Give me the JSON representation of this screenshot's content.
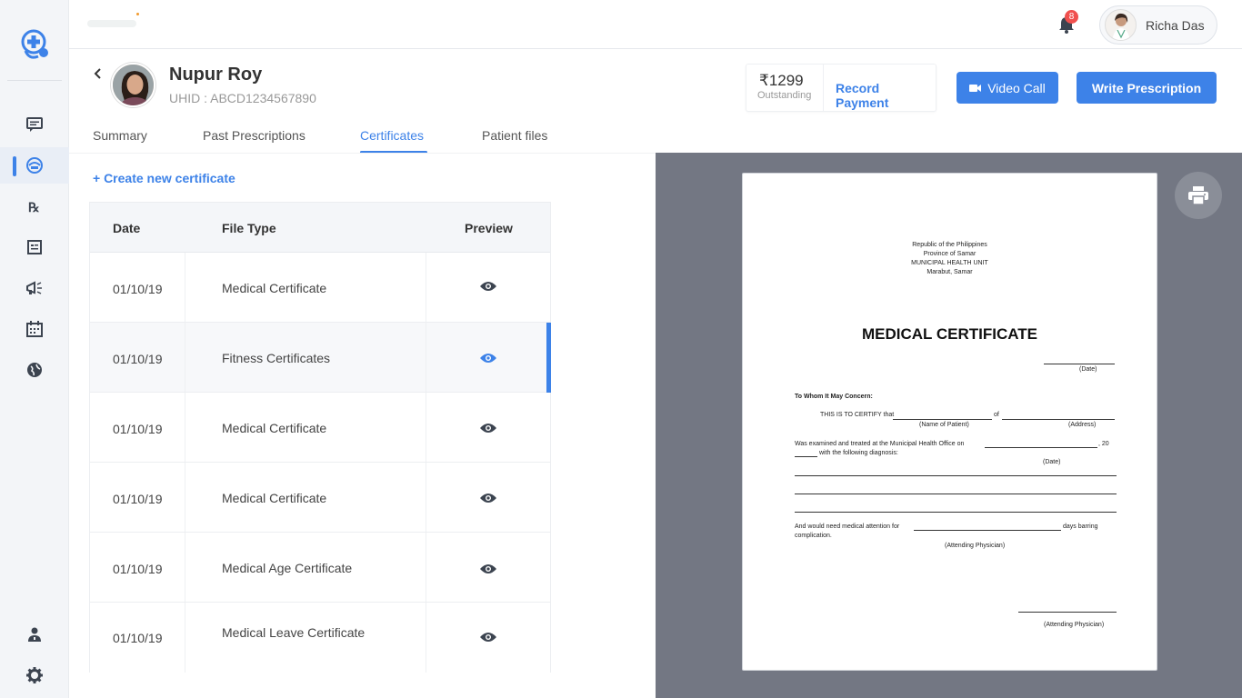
{
  "header": {
    "notification_count": "8",
    "user_name": "Richa Das"
  },
  "patient": {
    "name": "Nupur Roy",
    "uhid": "UHID : ABCD1234567890"
  },
  "payment": {
    "amount": "₹1299",
    "status": "Outstanding",
    "record_label": "Record Payment"
  },
  "actions": {
    "video_call": "Video Call",
    "write_prescription": "Write Prescription"
  },
  "tabs": [
    {
      "label": "Summary",
      "active": false
    },
    {
      "label": "Past Prescriptions",
      "active": false
    },
    {
      "label": "Certificates",
      "active": true
    },
    {
      "label": "Patient files",
      "active": false
    }
  ],
  "create_link": "+ Create new certificate",
  "table": {
    "columns": [
      "Date",
      "File Type",
      "Preview"
    ],
    "rows": [
      {
        "date": "01/10/19",
        "type": "Medical Certificate"
      },
      {
        "date": "01/10/19",
        "type": "Fitness Certificates"
      },
      {
        "date": "01/10/19",
        "type": "Medical Certificate"
      },
      {
        "date": "01/10/19",
        "type": "Medical Certificate"
      },
      {
        "date": "01/10/19",
        "type": "Medical Age Certificate"
      },
      {
        "date": "01/10/19",
        "type": "Medical Leave Certificate"
      }
    ],
    "selected_index": 1
  },
  "document": {
    "header_lines": [
      "Republic of the Philippines",
      "Province of Samar",
      "MUNICIPAL HEALTH UNIT",
      "Marabut, Samar"
    ],
    "title": "MEDICAL CERTIFICATE",
    "date_label": "(Date)",
    "salutation": "To Whom It May Concern:",
    "certify": "THIS IS TO CERTIFY that",
    "of": "of",
    "name_label": "(Name of Patient)",
    "address_label": "(Address)",
    "examined": "Was examined and treated at the Municipal Health Office on",
    "year": ", 20",
    "diagnosis": "with the following diagnosis:",
    "attention": "And would need medical attention for",
    "days_barring": "days barring",
    "complication": "complication.",
    "physician_label": "(Attending Physician)"
  },
  "colors": {
    "accent": "#3d82e8",
    "preview_bg": "#737783",
    "badge": "#f0504e"
  }
}
